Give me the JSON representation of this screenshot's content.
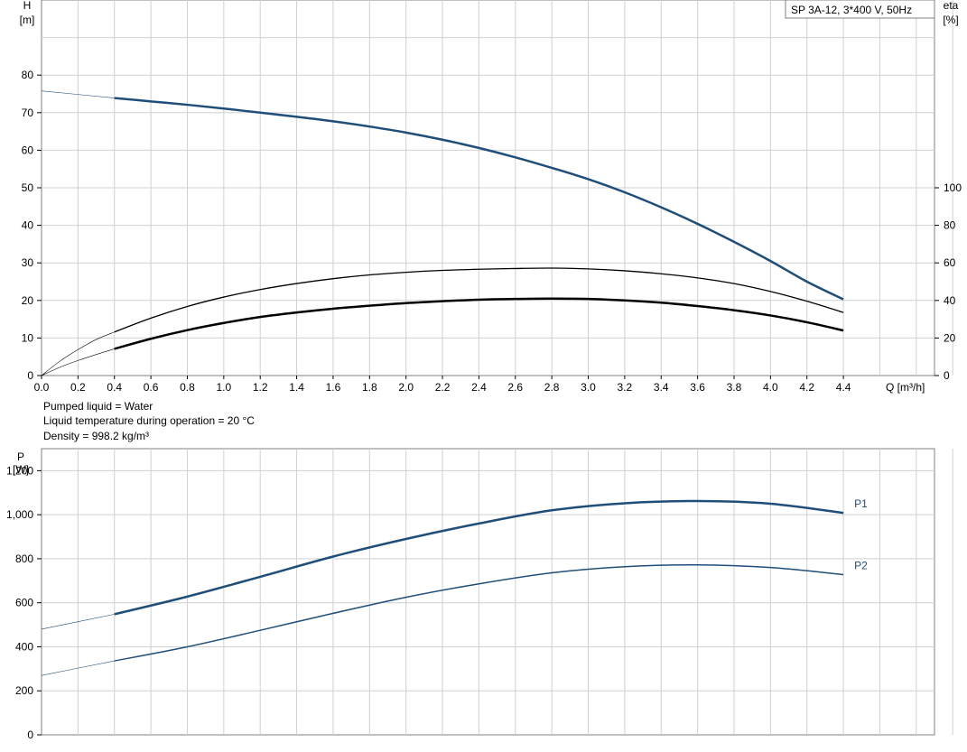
{
  "colors": {
    "blue": "#1f4e79",
    "black": "#000000",
    "grid": "#d0d0d0"
  },
  "chart_data": [
    {
      "type": "line",
      "title": "SP 3A-12, 3*400 V, 50Hz",
      "x_axis": {
        "label": "Q [m³/h]",
        "range": [
          0,
          4.9
        ],
        "tick_start": 0,
        "tick_end": 4.4,
        "tick_step": 0.2,
        "decimals": 1
      },
      "y_axis_left": {
        "label_top": "H",
        "label_unit": "[m]",
        "range": [
          0,
          100
        ],
        "ticks": [
          0,
          10,
          20,
          30,
          40,
          50,
          60,
          70,
          80
        ]
      },
      "y_axis_right": {
        "label_top": "eta",
        "label_unit": "[%]",
        "range": [
          0,
          200
        ],
        "ticks": [
          0,
          20,
          40,
          60,
          80,
          100
        ]
      },
      "series": [
        {
          "axis": "left",
          "color": "#1f4e79",
          "width": 2.5,
          "extension": [
            [
              0,
              75.8
            ],
            [
              0.4,
              73.9
            ]
          ],
          "points": [
            [
              0.4,
              73.9
            ],
            [
              0.6,
              73.0
            ],
            [
              0.8,
              72.1
            ],
            [
              1.0,
              71.1
            ],
            [
              1.2,
              70.0
            ],
            [
              1.4,
              68.9
            ],
            [
              1.6,
              67.7
            ],
            [
              1.8,
              66.3
            ],
            [
              2.0,
              64.7
            ],
            [
              2.2,
              62.8
            ],
            [
              2.4,
              60.6
            ],
            [
              2.6,
              58.1
            ],
            [
              2.8,
              55.3
            ],
            [
              3.0,
              52.3
            ],
            [
              3.2,
              48.8
            ],
            [
              3.4,
              44.8
            ],
            [
              3.6,
              40.4
            ],
            [
              3.8,
              35.6
            ],
            [
              4.0,
              30.5
            ],
            [
              4.2,
              25.0
            ],
            [
              4.4,
              20.3
            ]
          ]
        },
        {
          "axis": "left",
          "color": "#000000",
          "width": 1.3,
          "extension": [
            [
              0,
              0
            ],
            [
              0.1,
              3.8
            ],
            [
              0.2,
              6.9
            ],
            [
              0.3,
              9.6
            ],
            [
              0.4,
              11.6
            ]
          ],
          "points": [
            [
              0.4,
              11.6
            ],
            [
              0.6,
              15.3
            ],
            [
              0.8,
              18.4
            ],
            [
              1.0,
              20.9
            ],
            [
              1.2,
              22.9
            ],
            [
              1.4,
              24.5
            ],
            [
              1.6,
              25.8
            ],
            [
              1.8,
              26.8
            ],
            [
              2.0,
              27.5
            ],
            [
              2.2,
              28.0
            ],
            [
              2.4,
              28.3
            ],
            [
              2.6,
              28.5
            ],
            [
              2.8,
              28.6
            ],
            [
              3.0,
              28.4
            ],
            [
              3.2,
              27.9
            ],
            [
              3.4,
              27.1
            ],
            [
              3.6,
              26.0
            ],
            [
              3.8,
              24.5
            ],
            [
              4.0,
              22.4
            ],
            [
              4.2,
              19.8
            ],
            [
              4.4,
              16.8
            ]
          ]
        },
        {
          "axis": "left",
          "color": "#000000",
          "width": 2.5,
          "extension": [
            [
              0,
              0
            ],
            [
              0.1,
              2.2
            ],
            [
              0.2,
              4.0
            ],
            [
              0.3,
              5.6
            ],
            [
              0.4,
              7.1
            ]
          ],
          "points": [
            [
              0.4,
              7.1
            ],
            [
              0.6,
              9.8
            ],
            [
              0.8,
              12.1
            ],
            [
              1.0,
              14.0
            ],
            [
              1.2,
              15.6
            ],
            [
              1.4,
              16.8
            ],
            [
              1.6,
              17.8
            ],
            [
              1.8,
              18.6
            ],
            [
              2.0,
              19.3
            ],
            [
              2.2,
              19.8
            ],
            [
              2.4,
              20.2
            ],
            [
              2.6,
              20.4
            ],
            [
              2.8,
              20.5
            ],
            [
              3.0,
              20.4
            ],
            [
              3.2,
              20.0
            ],
            [
              3.4,
              19.4
            ],
            [
              3.6,
              18.5
            ],
            [
              3.8,
              17.4
            ],
            [
              4.0,
              16.0
            ],
            [
              4.2,
              14.2
            ],
            [
              4.4,
              12.0
            ]
          ]
        }
      ],
      "notes": [
        "Pumped liquid = Water",
        "Liquid temperature during operation = 20 °C",
        "Density = 998.2 kg/m³"
      ]
    },
    {
      "type": "line",
      "x_axis": {
        "range": [
          0,
          4.9
        ],
        "grid_step": 0.2
      },
      "y_axis_left": {
        "label_top": "P",
        "label_unit": "[W]",
        "range": [
          0,
          1300
        ],
        "ticks": [
          0,
          200,
          400,
          600,
          800,
          1000,
          1200
        ],
        "tick_labels": [
          "0",
          "200",
          "400",
          "600",
          "800",
          "1,000",
          "1,200"
        ]
      },
      "series": [
        {
          "name": "P1",
          "color": "#1f4e79",
          "width": 2.5,
          "extension": [
            [
              0,
              480
            ],
            [
              0.4,
              548
            ]
          ],
          "points": [
            [
              0.4,
              548
            ],
            [
              0.8,
              628
            ],
            [
              1.2,
              718
            ],
            [
              1.6,
              810
            ],
            [
              2.0,
              890
            ],
            [
              2.4,
              960
            ],
            [
              2.8,
              1020
            ],
            [
              3.2,
              1052
            ],
            [
              3.6,
              1062
            ],
            [
              4.0,
              1050
            ],
            [
              4.4,
              1008
            ]
          ]
        },
        {
          "name": "P2",
          "color": "#1f4e79",
          "width": 1.5,
          "extension": [
            [
              0,
              270
            ],
            [
              0.4,
              336
            ]
          ],
          "points": [
            [
              0.4,
              336
            ],
            [
              0.8,
              400
            ],
            [
              1.2,
              475
            ],
            [
              1.6,
              552
            ],
            [
              2.0,
              625
            ],
            [
              2.4,
              686
            ],
            [
              2.8,
              736
            ],
            [
              3.2,
              764
            ],
            [
              3.6,
              772
            ],
            [
              4.0,
              760
            ],
            [
              4.4,
              728
            ]
          ]
        }
      ]
    }
  ]
}
